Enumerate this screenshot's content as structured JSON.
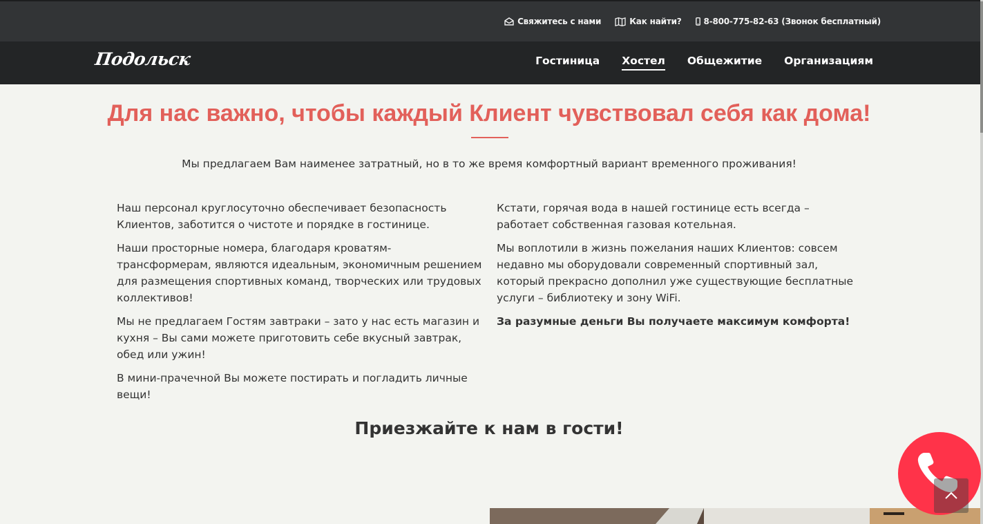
{
  "topbar": {
    "contact": {
      "label": "Свяжитесь с нами",
      "icon": "envelope-open-icon"
    },
    "find": {
      "label": "Как найти?",
      "icon": "map-icon"
    },
    "phone": {
      "label": "8-800-775-82-63 (Звонок бесплатный)",
      "icon": "mobile-phone-icon"
    }
  },
  "header": {
    "logo": "Подольск",
    "nav": [
      "Гостиница",
      "Хостел",
      "Общежитие",
      "Организациям"
    ],
    "active_nav": "Хостел"
  },
  "main": {
    "headline": "Для нас важно, чтобы каждый Клиент чувствовал себя как дома!",
    "intro": "Мы предлагаем Вам наименее затратный, но в то же время комфортный вариант временного проживания!",
    "left_column": [
      "Наш персонал круглосуточно  обеспечивает безопасность Клиентов, заботится о чистоте и порядке в гостинице.",
      "Наши просторные номера, благодаря кроватям-трансформерам, являются идеальным, экономичным решением для размещения спортивных команд, творческих или трудовых коллективов!",
      "Мы не предлагаем Гостям завтраки – зато у нас  есть магазин и кухня – Вы сами можете приготовить себе вкусный завтрак, обед или ужин!",
      "В мини-прачечной Вы можете постирать и погладить личные вещи!"
    ],
    "right_column": [
      "Кстати, горячая вода в нашей гостинице есть всегда – работает собственная газовая котельная.",
      "Мы воплотили в жизнь пожелания наших Клиентов:  совсем недавно мы оборудовали современный спортивный зал, который прекрасно дополнил уже существующие бесплатные услуги – библиотеку и зону WiFi."
    ],
    "right_bold": "За разумные деньги Вы получаете максимум комфорта!",
    "cta": "Приезжайте к нам в гости!"
  },
  "widgets": {
    "call_icon": "phone-icon",
    "scroll_top_icon": "chevron-up-icon"
  },
  "colors": {
    "accent": "#e2605a",
    "topbar": "#323436",
    "navbar": "#232526",
    "page_bg": "#f3f4f0",
    "call_button": "#ff3349"
  }
}
